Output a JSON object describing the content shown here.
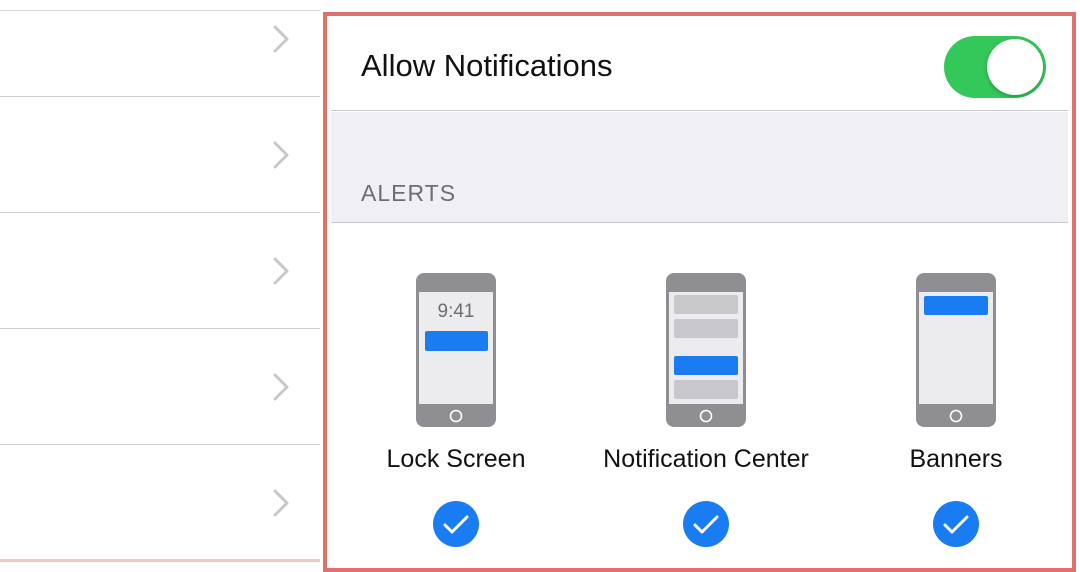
{
  "colors": {
    "accent_blue": "#1a7cf2",
    "toggle_green": "#34c759",
    "highlight_red": "#e0706b",
    "group_bg": "#efeff4",
    "phone_gray": "#8e8e93"
  },
  "left_list": {
    "rows": [
      {
        "icon": "chevron-right-icon"
      },
      {
        "icon": "chevron-right-icon"
      },
      {
        "icon": "chevron-right-icon"
      },
      {
        "icon": "chevron-right-icon"
      },
      {
        "icon": "chevron-right-icon"
      }
    ]
  },
  "allow_notifications": {
    "label": "Allow Notifications",
    "enabled": true
  },
  "alerts": {
    "header": "ALERTS",
    "options": [
      {
        "label": "Lock Screen",
        "preview_time": "9:41",
        "checked": true,
        "icon": "lock-screen-phone-icon"
      },
      {
        "label": "Notification Center",
        "checked": true,
        "icon": "notification-center-phone-icon"
      },
      {
        "label": "Banners",
        "checked": true,
        "icon": "banners-phone-icon"
      }
    ]
  }
}
